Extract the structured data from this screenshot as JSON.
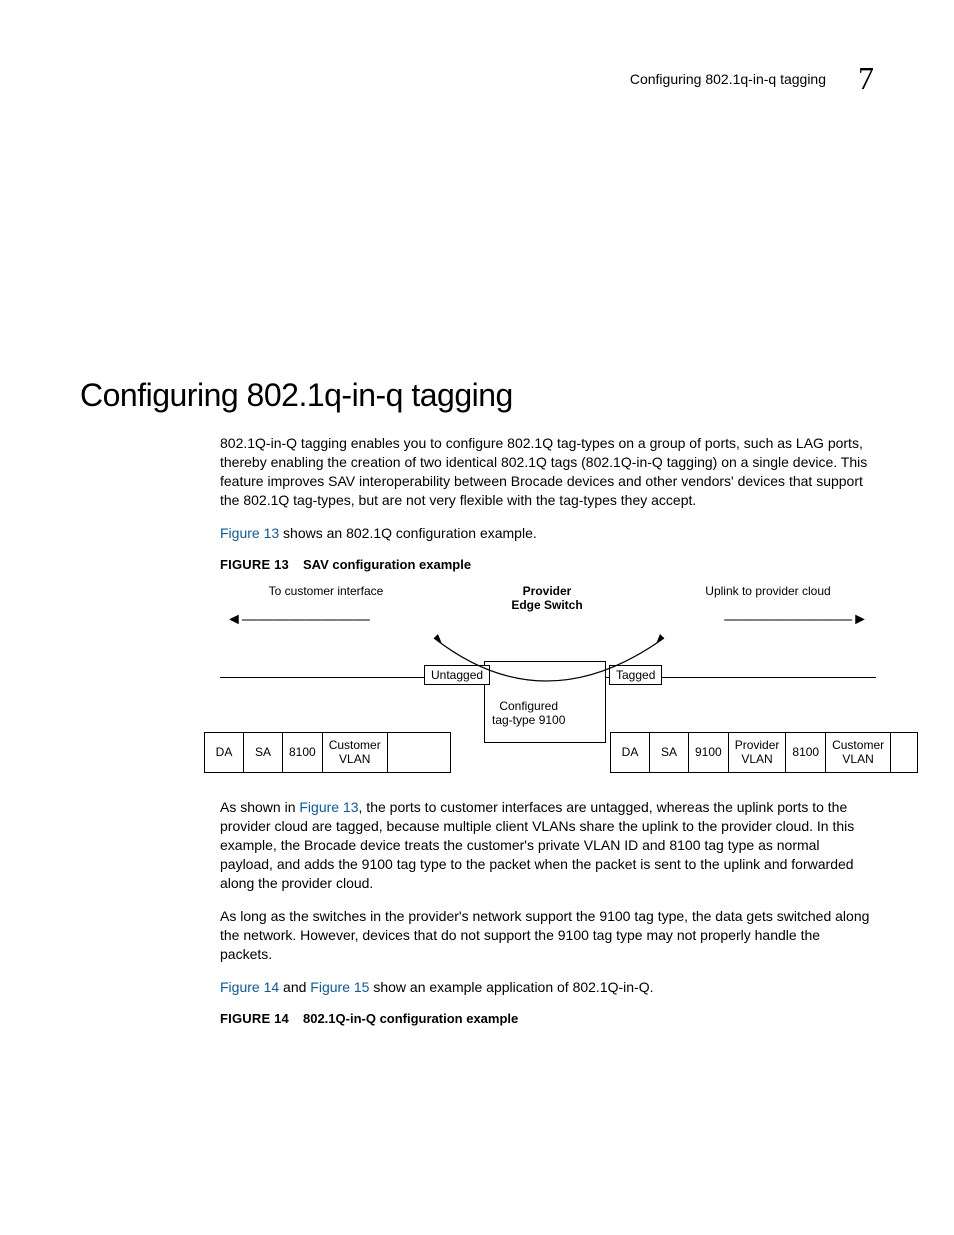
{
  "header": {
    "section": "Configuring 802.1q-in-q tagging",
    "chapter": "7"
  },
  "title": "Configuring 802.1q-in-q tagging",
  "para1": "802.1Q-in-Q tagging enables you to configure 802.1Q tag-types on a group of ports, such as LAG ports, thereby enabling the creation of two identical 802.1Q tags (802.1Q-in-Q tagging) on a single device. This feature improves SAV interoperability between Brocade devices and other vendors' devices that support the 802.1Q tag-types, but are not very flexible with the tag-types they accept.",
  "para2_link": "Figure 13",
  "para2_rest": " shows an 802.1Q configuration example.",
  "fig13": {
    "label": "FIGURE 13",
    "caption": "SAV configuration example"
  },
  "diagram": {
    "left_top": "To customer interface",
    "center_top_a": "Provider",
    "center_top_b": "Edge Switch",
    "right_top": "Uplink to provider cloud",
    "untagged": "Untagged",
    "tagged": "Tagged",
    "conf_a": "Configured",
    "conf_b": "tag-type 9100",
    "pkt_left": [
      "DA",
      "SA",
      "8100",
      "Customer\nVLAN",
      ""
    ],
    "pkt_right": [
      "DA",
      "SA",
      "9100",
      "Provider\nVLAN",
      "8100",
      "Customer\nVLAN",
      ""
    ]
  },
  "para3_pre": "As shown in ",
  "para3_link": "Figure 13",
  "para3_post": ", the ports to customer interfaces are untagged, whereas the uplink ports to the provider cloud are tagged, because multiple client VLANs share the uplink to the provider cloud. In this example, the Brocade device treats the customer's private VLAN ID and 8100 tag type as normal payload, and adds the 9100 tag type to the packet when the packet is sent to the uplink and forwarded along the provider cloud.",
  "para4": "As long as the switches in the provider's network support the 9100 tag type, the data gets switched along the network. However, devices that do not support the 9100 tag type may not properly handle the packets.",
  "para5_link1": "Figure 14",
  "para5_mid": " and ",
  "para5_link2": "Figure 15",
  "para5_post": " show an example application of 802.1Q-in-Q.",
  "fig14": {
    "label": "FIGURE 14",
    "caption": "802.1Q-in-Q configuration example"
  }
}
